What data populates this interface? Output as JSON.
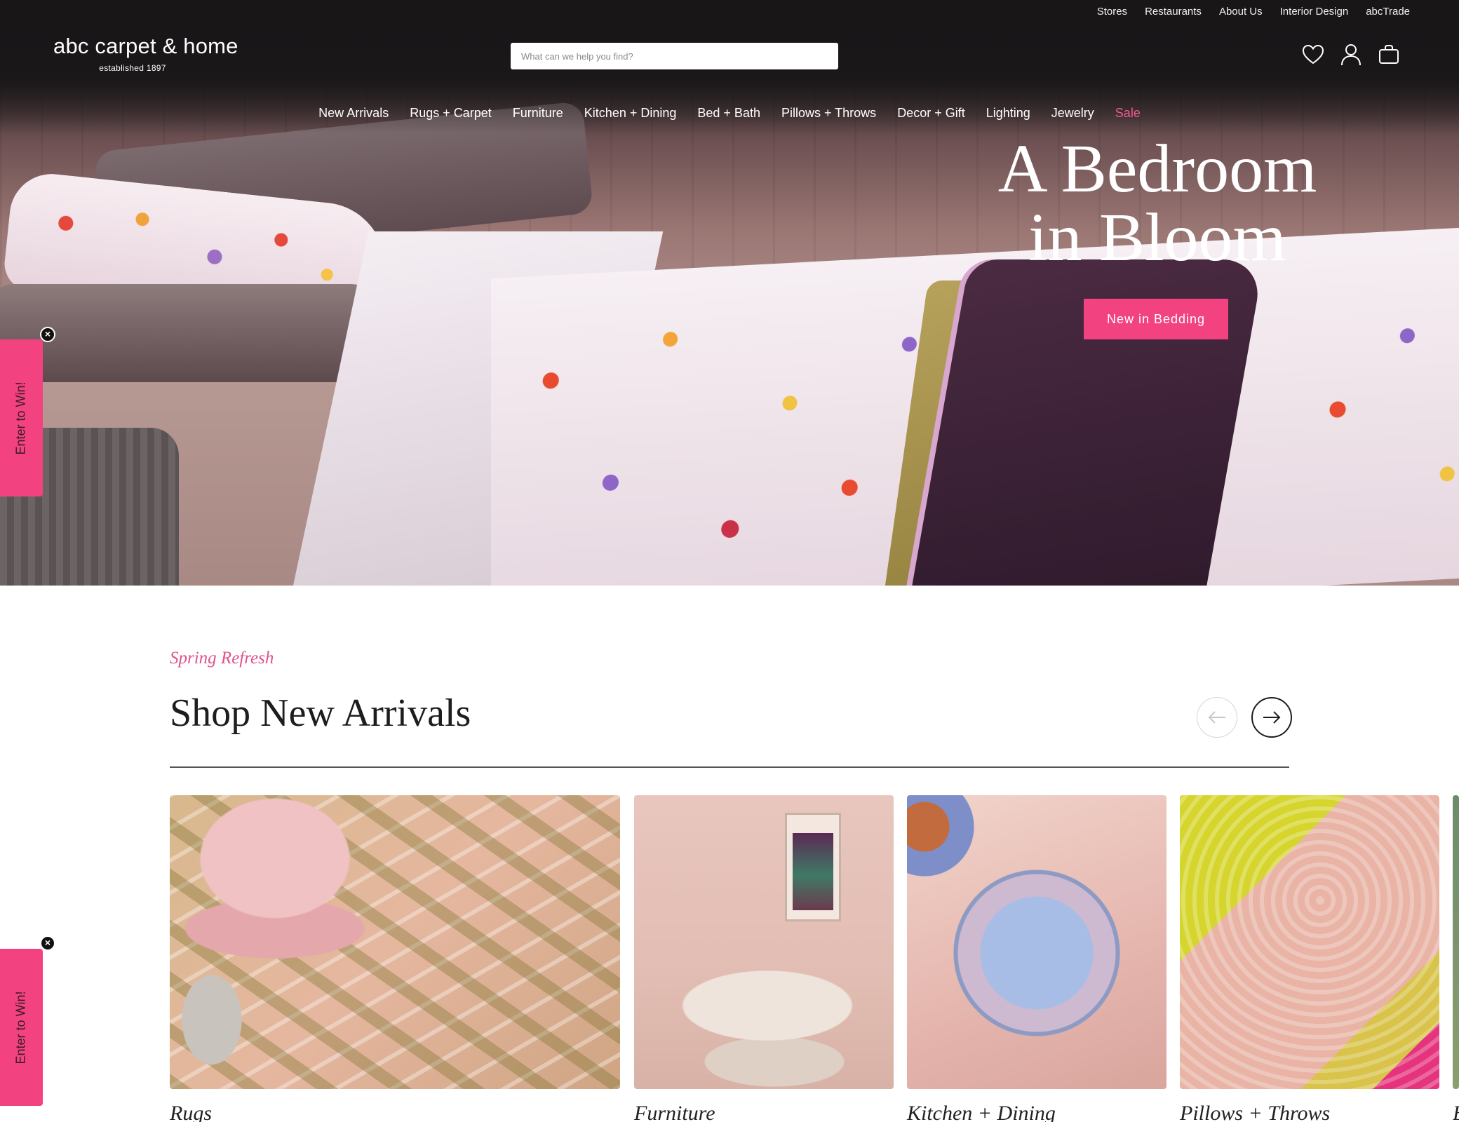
{
  "utility_nav": [
    "Stores",
    "Restaurants",
    "About Us",
    "Interior Design",
    "abcTrade"
  ],
  "logo": {
    "name": "abc carpet & home",
    "tagline": "established 1897"
  },
  "search": {
    "placeholder": "What can we help you find?"
  },
  "header_icons": [
    "heart-icon",
    "account-icon",
    "bag-icon"
  ],
  "main_nav": [
    "New Arrivals",
    "Rugs + Carpet",
    "Furniture",
    "Kitchen + Dining",
    "Bed + Bath",
    "Pillows + Throws",
    "Decor + Gift",
    "Lighting",
    "Jewelry",
    "Sale"
  ],
  "hero": {
    "title_line1": "A Bedroom",
    "title_line2": "in Bloom",
    "cta": "New in Bedding"
  },
  "promo_tab": {
    "label": "Enter to Win!",
    "close": "×"
  },
  "new_arrivals": {
    "eyebrow": "Spring Refresh",
    "title": "Shop New Arrivals",
    "cards": [
      {
        "label": "Rugs"
      },
      {
        "label": "Furniture"
      },
      {
        "label": "Kitchen + Dining"
      },
      {
        "label": "Pillows + Throws"
      },
      {
        "label": "B"
      }
    ]
  },
  "colors": {
    "accent_pink": "#f2427f",
    "sale_pink": "#f25a93",
    "eyebrow_pink": "#e0528c",
    "header_bg": "#1c1a1b"
  }
}
